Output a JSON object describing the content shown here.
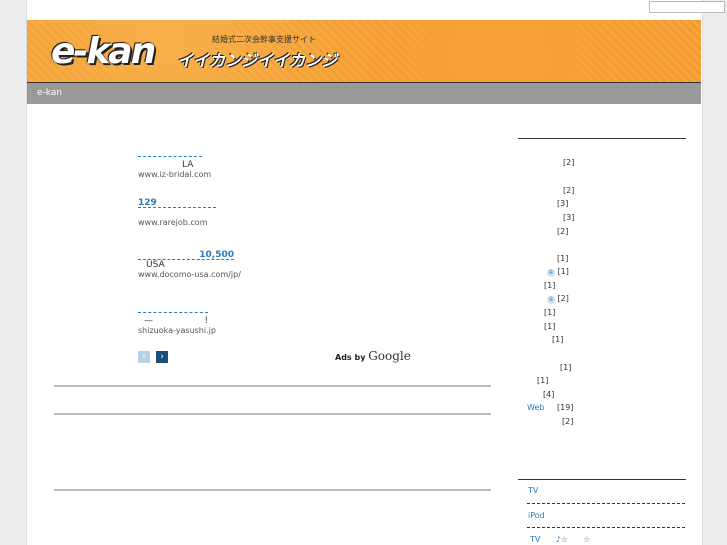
{
  "header": {
    "logo": "e-kan",
    "logo_sub": "イイカンジイイカンジ",
    "logo_tag": "結婚式二次会幹事支援サイト",
    "nav_label": "e-kan"
  },
  "ads": [
    {
      "title": "",
      "desc": "LA",
      "url": "www.iz-bridal.com"
    },
    {
      "title": "129",
      "desc": "",
      "url": "www.rarejob.com"
    },
    {
      "title": "10,500",
      "desc": "USA",
      "url": "www.docomo-usa.com/jp/"
    },
    {
      "title": "",
      "desc": "—                  !",
      "url": "shizuoka-yasushi.jp"
    }
  ],
  "ads_by": "Ads by",
  "google": "Google",
  "categories": [
    {
      "label": "",
      "count": "[2]"
    },
    {
      "label": "",
      "count": "[2]"
    },
    {
      "label": "",
      "count": "[3]"
    },
    {
      "label": "",
      "count": "[3]"
    },
    {
      "label": "",
      "count": "[2]"
    },
    {
      "label": "",
      "count": "[1]"
    },
    {
      "label": "①",
      "count": "[1]"
    },
    {
      "label": "",
      "count": "[1]"
    },
    {
      "label": "②",
      "count": "[2]"
    },
    {
      "label": "",
      "count": "[1]"
    },
    {
      "label": "",
      "count": "[1]"
    },
    {
      "label": "",
      "count": "[1]"
    },
    {
      "label": "",
      "count": "[1]"
    },
    {
      "label": "",
      "count": "[1]"
    },
    {
      "label": "",
      "count": "[4]"
    },
    {
      "label": "Web",
      "count": "[19]"
    },
    {
      "label": "",
      "count": "[2]"
    }
  ],
  "links": [
    "TV",
    "iPod",
    "TV      ♪☆      ☆"
  ],
  "colors": {
    "accent": "#2a7bbd",
    "banner": "#f29a2e",
    "nav": "#999999"
  }
}
